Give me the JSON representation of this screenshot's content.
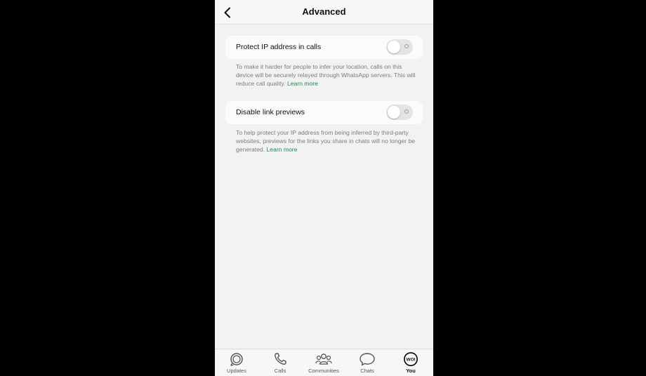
{
  "header": {
    "title": "Advanced",
    "back_icon": "chevron-left-icon"
  },
  "settings": [
    {
      "label": "Protect IP address in calls",
      "enabled": false,
      "description": "To make it harder for people to infer your location, calls on this device will be securely relayed through WhatsApp servers. This will reduce call quality.",
      "link": "Learn more"
    },
    {
      "label": "Disable link previews",
      "enabled": false,
      "description": "To help protect your IP address from being inferred by third-party websites, previews for the links you share in chats will no longer be generated.",
      "link": "Learn more"
    }
  ],
  "tabs": [
    {
      "label": "Updates",
      "icon": "updates-icon",
      "active": false
    },
    {
      "label": "Calls",
      "icon": "phone-icon",
      "active": false
    },
    {
      "label": "Communities",
      "icon": "communities-icon",
      "active": false
    },
    {
      "label": "Chats",
      "icon": "chat-bubble-icon",
      "active": false
    },
    {
      "label": "You",
      "icon": "profile-avatar-icon",
      "avatar_text": "WOI",
      "active": true
    }
  ],
  "colors": {
    "accent": "#1f8a4c",
    "background": "#f2f2f2",
    "card": "#fbfbfb",
    "toggle_off": "#e4e4e6"
  }
}
